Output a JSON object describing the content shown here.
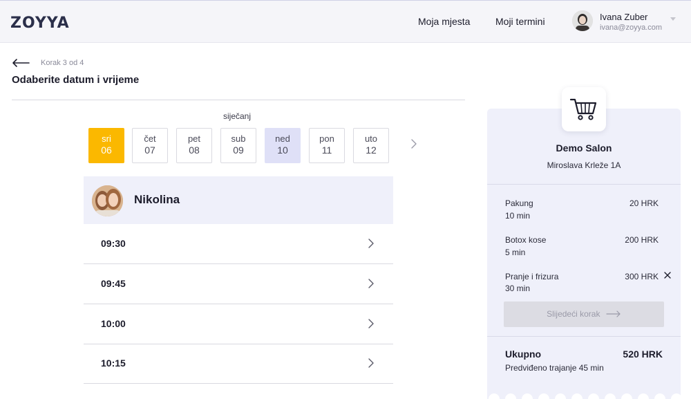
{
  "header": {
    "logo_text": "ZOYYA",
    "nav": [
      {
        "label": "Moja mjesta"
      },
      {
        "label": "Moji termini"
      }
    ],
    "user": {
      "name": "Ivana Zuber",
      "email": "ivana@zoyya.com"
    }
  },
  "step": {
    "label": "Korak 3 od 4",
    "title": "Odaberite datum i vrijeme"
  },
  "calendar": {
    "month": "siječanj",
    "days": [
      {
        "name": "sri",
        "num": "06",
        "state": "selected"
      },
      {
        "name": "čet",
        "num": "07",
        "state": "normal"
      },
      {
        "name": "pet",
        "num": "08",
        "state": "normal"
      },
      {
        "name": "sub",
        "num": "09",
        "state": "normal"
      },
      {
        "name": "ned",
        "num": "10",
        "state": "highlight"
      },
      {
        "name": "pon",
        "num": "11",
        "state": "normal"
      },
      {
        "name": "uto",
        "num": "12",
        "state": "normal"
      }
    ]
  },
  "staff": {
    "name": "Nikolina"
  },
  "slots": [
    {
      "time": "09:30"
    },
    {
      "time": "09:45"
    },
    {
      "time": "10:00"
    },
    {
      "time": "10:15"
    }
  ],
  "cart": {
    "salon_name": "Demo Salon",
    "salon_address": "Miroslava Krleže 1A",
    "services": [
      {
        "name": "Pakung",
        "duration": "10 min",
        "price": "20 HRK"
      },
      {
        "name": "Botox kose",
        "duration": "5 min",
        "price": "200 HRK"
      },
      {
        "name": "Pranje i frizura",
        "duration": "30 min",
        "price": "300 HRK"
      }
    ],
    "next_button": "Slijedeći korak",
    "total_label": "Ukupno",
    "total_value": "520 HRK",
    "total_duration": "Predviđeno trajanje 45 min"
  },
  "colors": {
    "accent": "#fbb800",
    "highlight": "#dfe0f7",
    "panel": "#eff0fa"
  },
  "icons": [
    "back-arrow-icon",
    "chevron-right-icon",
    "cart-icon",
    "close-icon",
    "arrow-right-icon",
    "caret-down-icon"
  ]
}
